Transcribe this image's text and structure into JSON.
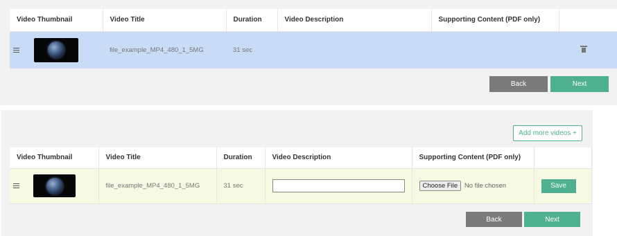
{
  "panel1": {
    "headers": [
      "Video Thumbnail",
      "Video Title",
      "Duration",
      "Video Description",
      "Supporting Content (PDF only)",
      ""
    ],
    "row": {
      "title": "file_example_MP4_480_1_5MG",
      "duration": "31 sec",
      "description": "",
      "delete_icon": "trash-icon"
    },
    "back_label": "Back",
    "next_label": "Next"
  },
  "panel2": {
    "add_more_label": "Add more videos +",
    "headers": [
      "Video Thumbnail",
      "Video Title",
      "Duration",
      "Video Description",
      "Supporting Content (PDF only)",
      ""
    ],
    "row": {
      "title": "file_example_MP4_480_1_5MG",
      "duration": "31 sec",
      "description_value": "",
      "choose_file_label": "Choose File",
      "file_status": "No file chosen",
      "save_label": "Save"
    },
    "back_label": "Back",
    "next_label": "Next"
  },
  "colors": {
    "accent": "#4fb092",
    "back": "#7b7b7b",
    "row_selected": "#c8dcf5",
    "row_edit": "#f7f9e3",
    "panel_bg": "#f2f2f2"
  }
}
